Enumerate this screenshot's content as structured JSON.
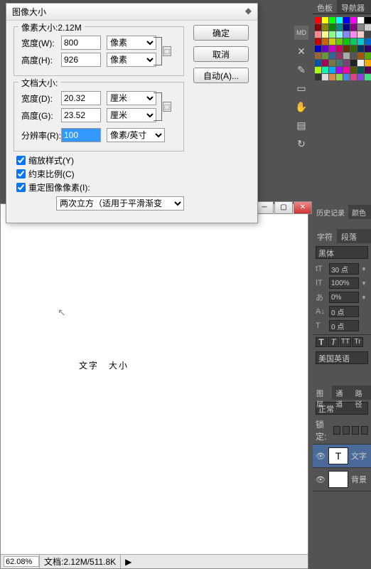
{
  "dialog": {
    "title": "图像大小",
    "pixel_section": {
      "legend": "像素大小:2.12M",
      "width_label": "宽度(W):",
      "width_val": "800",
      "height_label": "高度(H):",
      "height_val": "926",
      "unit": "像素"
    },
    "doc_section": {
      "legend": "文档大小:",
      "width_label": "宽度(D):",
      "width_val": "20.32",
      "height_label": "高度(G):",
      "height_val": "23.52",
      "unit": "厘米",
      "res_label": "分辨率(R):",
      "res_val": "100",
      "res_unit": "像素/英寸"
    },
    "chk_scale": "缩放样式(Y)",
    "chk_constrain": "约束比例(C)",
    "chk_resample": "重定图像像素(I):",
    "resample_method": "两次立方（适用于平滑渐变:▼",
    "resample_method_text": "两次立方（适用于平滑渐变",
    "ok": "确定",
    "cancel": "取消",
    "auto": "自动(A)..."
  },
  "canvas": {
    "text1": "文字",
    "text2": "大小"
  },
  "status": {
    "zoom": "62.08%",
    "doc": "文档:2.12M/511.8K"
  },
  "swatch_tabs": [
    "色板",
    "导航器"
  ],
  "hist_tabs": [
    "历史记录",
    "颜色"
  ],
  "char": {
    "tabs": [
      "字符",
      "段落"
    ],
    "font": "黑体",
    "size": "30 点",
    "leading": "100%",
    "tracking": "0%",
    "baseline": "0 点",
    "kerning": "0 点",
    "lang": "美国英语"
  },
  "layers": {
    "tabs": [
      "图层",
      "通道",
      "路径"
    ],
    "blend": "正常",
    "lock": "锁定:",
    "layer1": "文字",
    "layer2": "背景"
  },
  "swatch_colors": [
    "#f00",
    "#ff0",
    "#0f0",
    "#0ff",
    "#00f",
    "#f0f",
    "#fff",
    "#000",
    "#800",
    "#880",
    "#080",
    "#088",
    "#008",
    "#808",
    "#888",
    "#ccc",
    "#f88",
    "#ff8",
    "#8f8",
    "#8ff",
    "#88f",
    "#f8f",
    "#fcc",
    "#444",
    "#c00",
    "#c60",
    "#cc0",
    "#6c0",
    "#0c0",
    "#0c6",
    "#0cc",
    "#06c",
    "#00c",
    "#60c",
    "#c0c",
    "#c06",
    "#630",
    "#360",
    "#036",
    "#306",
    "#963",
    "#693",
    "#369",
    "#936",
    "#aaa",
    "#555",
    "#a50",
    "#5a0",
    "#05a",
    "#a05",
    "#774",
    "#477",
    "#747",
    "#222",
    "#eee",
    "#fa0",
    "#af0",
    "#0fa",
    "#0af",
    "#a0f",
    "#f0a",
    "#550",
    "#055",
    "#505",
    "#333",
    "#ddd",
    "#d84",
    "#8d4",
    "#48d",
    "#d48",
    "#84d",
    "#4d8"
  ]
}
